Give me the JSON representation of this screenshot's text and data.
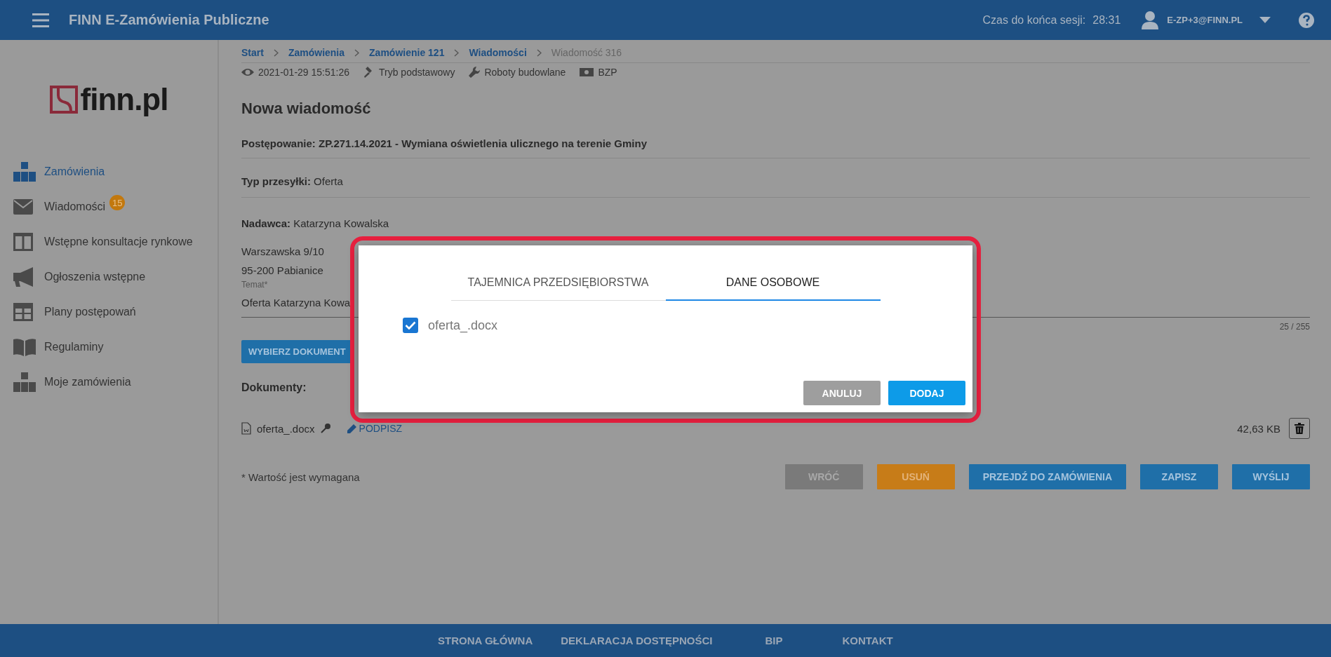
{
  "header": {
    "app_title": "FINN E-Zamówienia Publiczne",
    "session_label": "Czas do końca sesji:",
    "session_time": "28:31",
    "user": "E-ZP+3@FINN.PL"
  },
  "sidebar": {
    "logo_text": "finn.pl",
    "items": [
      {
        "label": "Zamówienia",
        "selected": true
      },
      {
        "label": "Wiadomości",
        "selected": false,
        "badge": "15"
      },
      {
        "label": "Wstępne konsultacje rynkowe",
        "selected": false
      },
      {
        "label": "Ogłoszenia wstępne",
        "selected": false
      },
      {
        "label": "Plany postępowań",
        "selected": false
      },
      {
        "label": "Regulaminy",
        "selected": false
      },
      {
        "label": "Moje zamówienia",
        "selected": false
      }
    ]
  },
  "breadcrumb": [
    {
      "label": "Start",
      "kind": "link"
    },
    {
      "label": "Zamówienia",
      "kind": "link"
    },
    {
      "label": "Zamówienie 121",
      "kind": "link"
    },
    {
      "label": "Wiadomości",
      "kind": "link"
    },
    {
      "label": "Wiadomość 316",
      "kind": "current"
    }
  ],
  "meta": [
    "2021-01-29 15:51:26",
    "Tryb podstawowy",
    "Roboty budowlane",
    "BZP"
  ],
  "page_title": "Nowa wiadomość",
  "proceeding": "Postępowanie: ZP.271.14.2021 - Wymiana oświetlenia ulicznego na terenie Gminy",
  "shipment": {
    "label": "Typ przesyłki:",
    "value": "Oferta"
  },
  "sender": {
    "label": "Nadawca:",
    "value": "Katarzyna Kowalska",
    "address": [
      "Warszawska 9/10",
      "95-200 Pabianice"
    ]
  },
  "subject": {
    "label": "Temat*",
    "value": "Oferta Katarzyna Kowa",
    "counter": "25 / 255"
  },
  "choose_button": "WYBIERZ DOKUMENT",
  "documents": {
    "label": "Dokumenty:",
    "files": [
      {
        "name": "oferta_.docx",
        "sign": "PODPISZ",
        "size": "42,63 KB"
      }
    ]
  },
  "required_note": "* Wartość jest wymagana",
  "actions": [
    {
      "label": "WRÓĆ",
      "kind": "grey"
    },
    {
      "label": "USUŃ",
      "kind": "orange"
    },
    {
      "label": "PRZEJDŹ DO ZAMÓWIENIA",
      "kind": "blue"
    },
    {
      "label": "ZAPISZ",
      "kind": "blue"
    },
    {
      "label": "WYŚLIJ",
      "kind": "blue"
    }
  ],
  "dialog": {
    "tabs": [
      {
        "label": "TAJEMNICA PRZEDSIĘBIORSTWA",
        "selected": false
      },
      {
        "label": "DANE OSOBOWE",
        "selected": true
      }
    ],
    "files": [
      {
        "name": "oferta_.docx",
        "checked": true
      }
    ],
    "buttons": [
      {
        "label": "ANULUJ",
        "kind": "cancel"
      },
      {
        "label": "DODAJ",
        "kind": "primary"
      }
    ]
  },
  "footer": [
    "STRONA GŁÓWNA",
    "DEKLARACJA DOSTĘPNOŚCI",
    "BIP",
    "KONTAKT"
  ]
}
